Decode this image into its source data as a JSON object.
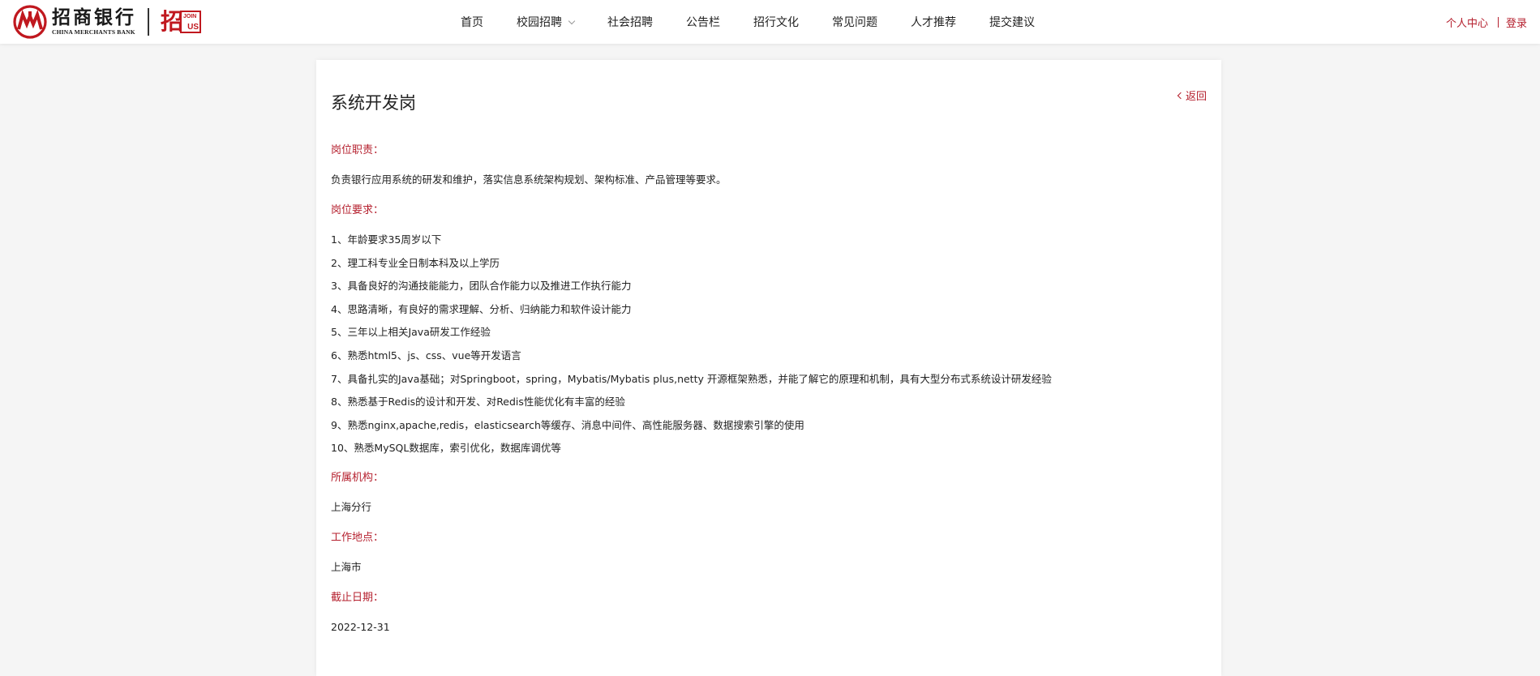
{
  "header": {
    "logo": {
      "name_cn": "招商银行",
      "name_en": "CHINA MERCHANTS BANK",
      "join_char": "招",
      "join_word": "JOIN",
      "join_us": "US"
    },
    "nav": [
      {
        "label": "首页",
        "has_dropdown": false
      },
      {
        "label": "校园招聘",
        "has_dropdown": true
      },
      {
        "label": "社会招聘",
        "has_dropdown": false
      },
      {
        "label": "公告栏",
        "has_dropdown": false
      },
      {
        "label": "招行文化",
        "has_dropdown": false
      },
      {
        "label": "常见问题",
        "has_dropdown": false
      },
      {
        "label": "人才推荐",
        "has_dropdown": false
      },
      {
        "label": "提交建议",
        "has_dropdown": false
      }
    ],
    "user_center": "个人中心",
    "login": "登录"
  },
  "job": {
    "title": "系统开发岗",
    "back_label": "返回",
    "duties_label": "岗位职责：",
    "duties_text": "负责银行应用系统的研发和维护，落实信息系统架构规划、架构标准、产品管理等要求。",
    "requirements_label": "岗位要求：",
    "requirements": [
      "1、年龄要求35周岁以下",
      "2、理工科专业全日制本科及以上学历",
      "3、具备良好的沟通技能能力，团队合作能力以及推进工作执行能力",
      "4、思路清晰，有良好的需求理解、分析、归纳能力和软件设计能力",
      "5、三年以上相关Java研发工作经验",
      "6、熟悉html5、js、css、vue等开发语言",
      "7、具备扎实的Java基础；对Springboot，spring，Mybatis/Mybatis plus,netty 开源框架熟悉，并能了解它的原理和机制，具有大型分布式系统设计研发经验",
      "8、熟悉基于Redis的设计和开发、对Redis性能优化有丰富的经验",
      "9、熟悉nginx,apache,redis，elasticsearch等缓存、消息中间件、高性能服务器、数据搜索引擎的使用",
      "10、熟悉MySQL数据库，索引优化，数据库调优等"
    ],
    "org_label": "所属机构：",
    "org_value": "上海分行",
    "location_label": "工作地点：",
    "location_value": "上海市",
    "deadline_label": "截止日期：",
    "deadline_value": "2022-12-31"
  },
  "colors": {
    "brand_red": "#c0181f",
    "accent_red": "#b5202e",
    "background": "#f5f5f5",
    "card": "#ffffff"
  }
}
